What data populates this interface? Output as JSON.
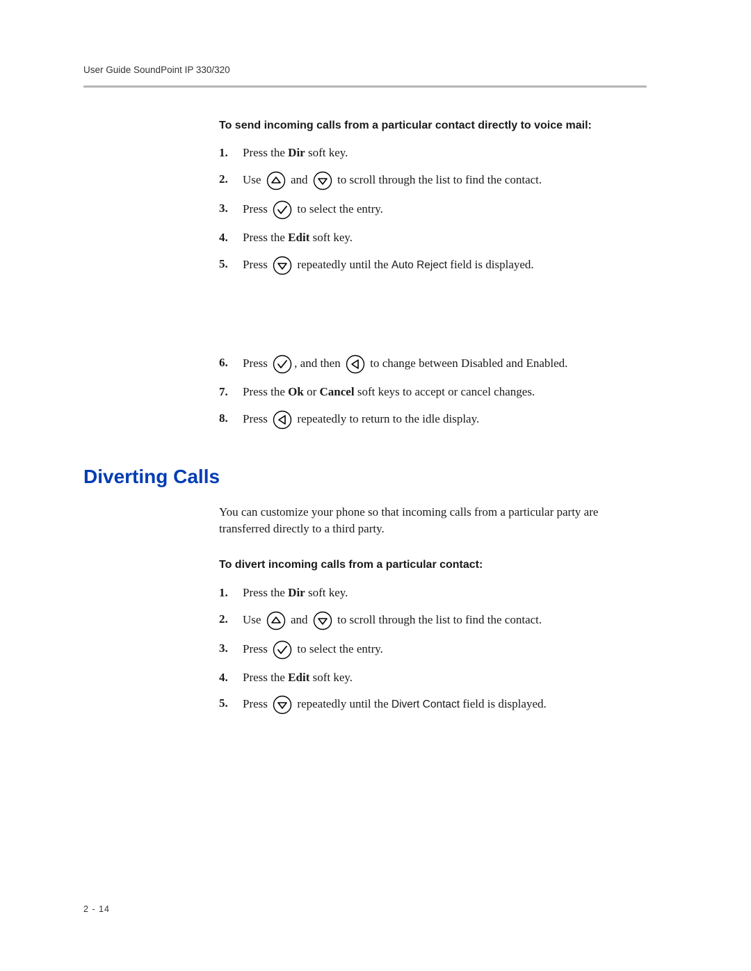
{
  "header": "User Guide SoundPoint IP 330/320",
  "page_number": "2 - 14",
  "section1": {
    "subhead": "To send incoming calls from a particular contact directly to voice mail:",
    "steps": [
      {
        "num": "1.",
        "parts": [
          {
            "t": "text",
            "v": "Press the "
          },
          {
            "t": "bold",
            "v": "Dir"
          },
          {
            "t": "text",
            "v": " soft key."
          }
        ]
      },
      {
        "num": "2.",
        "parts": [
          {
            "t": "text",
            "v": "Use "
          },
          {
            "t": "icon",
            "v": "up"
          },
          {
            "t": "text",
            "v": " and "
          },
          {
            "t": "icon",
            "v": "down"
          },
          {
            "t": "text",
            "v": " to scroll through the list to find the contact."
          }
        ]
      },
      {
        "num": "3.",
        "parts": [
          {
            "t": "text",
            "v": "Press "
          },
          {
            "t": "icon",
            "v": "check"
          },
          {
            "t": "text",
            "v": " to select the entry."
          }
        ]
      },
      {
        "num": "4.",
        "parts": [
          {
            "t": "text",
            "v": "Press the "
          },
          {
            "t": "bold",
            "v": "Edit"
          },
          {
            "t": "text",
            "v": " soft key."
          }
        ]
      },
      {
        "num": "5.",
        "parts": [
          {
            "t": "text",
            "v": "Press "
          },
          {
            "t": "icon",
            "v": "down"
          },
          {
            "t": "text",
            "v": " repeatedly until the "
          },
          {
            "t": "field",
            "v": "Auto Reject"
          },
          {
            "t": "text",
            "v": " field is displayed."
          }
        ]
      },
      {
        "num": "6.",
        "parts": [
          {
            "t": "text",
            "v": "Press "
          },
          {
            "t": "icon",
            "v": "check"
          },
          {
            "t": "text",
            "v": ", and then "
          },
          {
            "t": "icon",
            "v": "left"
          },
          {
            "t": "text",
            "v": " to change between Disabled and Enabled."
          }
        ]
      },
      {
        "num": "7.",
        "parts": [
          {
            "t": "text",
            "v": "Press the "
          },
          {
            "t": "bold",
            "v": "Ok"
          },
          {
            "t": "text",
            "v": " or "
          },
          {
            "t": "bold",
            "v": "Cancel"
          },
          {
            "t": "text",
            "v": " soft keys to accept or cancel changes."
          }
        ]
      },
      {
        "num": "8.",
        "parts": [
          {
            "t": "text",
            "v": "Press "
          },
          {
            "t": "icon",
            "v": "left"
          },
          {
            "t": "text",
            "v": " repeatedly to return to the idle display."
          }
        ]
      }
    ],
    "gap_after_index": 4
  },
  "section2": {
    "title": "Diverting Calls",
    "intro": "You can customize your phone so that incoming calls from a particular party are transferred directly to a third party.",
    "subhead": "To divert incoming calls from a particular contact:",
    "steps": [
      {
        "num": "1.",
        "parts": [
          {
            "t": "text",
            "v": "Press the "
          },
          {
            "t": "bold",
            "v": "Dir"
          },
          {
            "t": "text",
            "v": " soft key."
          }
        ]
      },
      {
        "num": "2.",
        "parts": [
          {
            "t": "text",
            "v": "Use "
          },
          {
            "t": "icon",
            "v": "up"
          },
          {
            "t": "text",
            "v": " and "
          },
          {
            "t": "icon",
            "v": "down"
          },
          {
            "t": "text",
            "v": " to scroll through the list to find the contact."
          }
        ]
      },
      {
        "num": "3.",
        "parts": [
          {
            "t": "text",
            "v": "Press "
          },
          {
            "t": "icon",
            "v": "check"
          },
          {
            "t": "text",
            "v": " to select the entry."
          }
        ]
      },
      {
        "num": "4.",
        "parts": [
          {
            "t": "text",
            "v": "Press the "
          },
          {
            "t": "bold",
            "v": "Edit"
          },
          {
            "t": "text",
            "v": " soft key."
          }
        ]
      },
      {
        "num": "5.",
        "parts": [
          {
            "t": "text",
            "v": "Press "
          },
          {
            "t": "icon",
            "v": "down"
          },
          {
            "t": "text",
            "v": " repeatedly until the "
          },
          {
            "t": "field",
            "v": "Divert Contact"
          },
          {
            "t": "text",
            "v": " field is displayed."
          }
        ]
      }
    ]
  }
}
